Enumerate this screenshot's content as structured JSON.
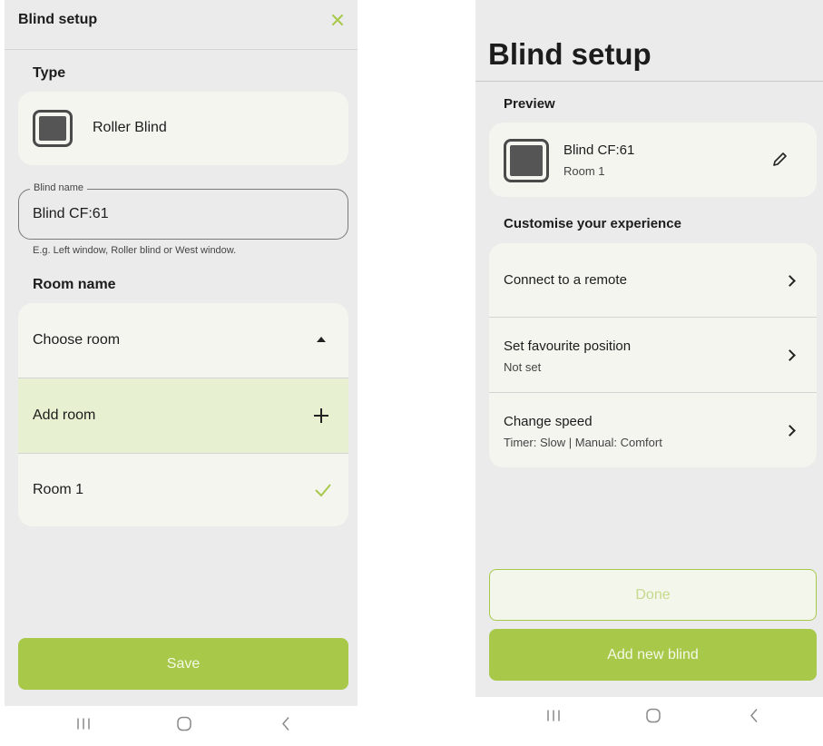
{
  "colors": {
    "accent": "#a8c84a",
    "selected_bg": "#e7f0d0",
    "screen_bg": "#ebebeb",
    "card_bg": "#f5f5f0"
  },
  "left": {
    "header_title": "Blind setup",
    "close_icon": "close-icon",
    "type_heading": "Type",
    "type_value": "Roller Blind",
    "blind_name_label": "Blind name",
    "blind_name_value": "Blind CF:61",
    "blind_name_hint": "E.g. Left window, Roller blind or West window.",
    "room_heading": "Room name",
    "room_dropdown_label": "Choose room",
    "add_room_label": "Add room",
    "room_option": "Room 1",
    "save_label": "Save"
  },
  "right": {
    "title": "Blind setup",
    "preview_heading": "Preview",
    "preview_name": "Blind CF:61",
    "preview_room": "Room 1",
    "customise_heading": "Customise your experience",
    "options": [
      {
        "label": "Connect to a remote",
        "sub": ""
      },
      {
        "label": "Set favourite position",
        "sub": "Not set"
      },
      {
        "label": "Change speed",
        "sub": "Timer: Slow | Manual: Comfort"
      }
    ],
    "done_label": "Done",
    "add_new_label": "Add new blind"
  }
}
